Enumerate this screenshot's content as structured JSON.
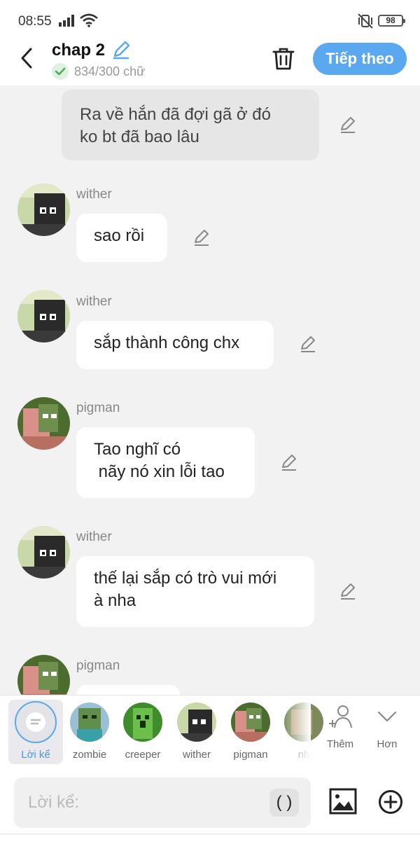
{
  "status_bar": {
    "time": "08:55",
    "battery": "98"
  },
  "header": {
    "title": "chap 2",
    "word_count": "834/300 chữ",
    "next_label": "Tiếp theo"
  },
  "messages": [
    {
      "type": "narration",
      "lines": [
        "Ra về hắn đã đợi gã ở đó",
        "ko bt đã bao lâu"
      ]
    },
    {
      "type": "dialog",
      "name": "wither",
      "lines": [
        "sao rồi"
      ]
    },
    {
      "type": "dialog",
      "name": "wither",
      "lines": [
        "sắp thành công chx"
      ]
    },
    {
      "type": "dialog",
      "name": "pigman",
      "lines": [
        "Tao nghĩ có",
        " nãy nó xin lỗi tao"
      ]
    },
    {
      "type": "dialog",
      "name": "wither",
      "lines": [
        "thế lại sắp có trò vui mới",
        "à nha"
      ]
    },
    {
      "type": "dialog",
      "name": "pigman",
      "lines": [
        ""
      ]
    }
  ],
  "characters": {
    "narrator_label": "Lời kể",
    "items": [
      "zombie",
      "creeper",
      "wither",
      "pigman",
      "nh"
    ],
    "add_label": "Thêm",
    "more_label": "Hơn"
  },
  "input": {
    "placeholder": "Lời kể:",
    "paren_label": "( )"
  },
  "colors": {
    "accent": "#5aa8f0",
    "narration_bg": "#e6e6e6",
    "check_green": "#4caf50"
  }
}
